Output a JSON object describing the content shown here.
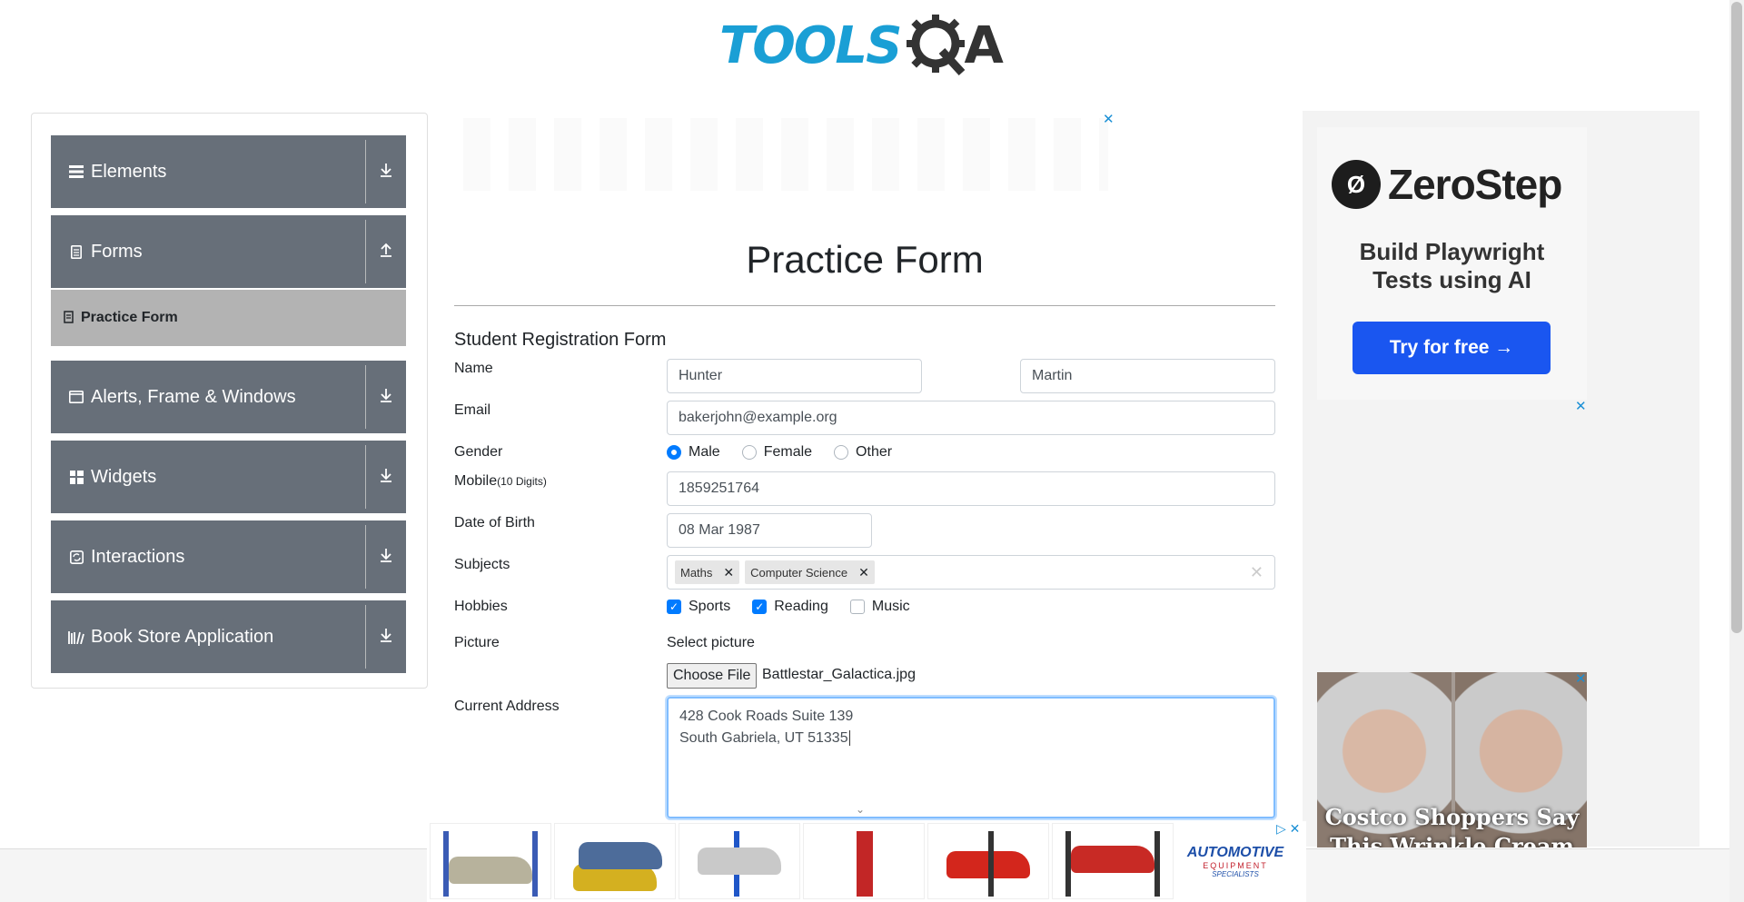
{
  "logo": {
    "text": "TOOLS",
    "tail": "A"
  },
  "sidebar": {
    "groups": [
      {
        "label": "Elements",
        "icon": "menu-icon",
        "arrow": "download-arrow-icon"
      },
      {
        "label": "Forms",
        "icon": "file-icon",
        "arrow": "upload-arrow-icon"
      },
      {
        "label": "Alerts, Frame & Windows",
        "icon": "window-icon",
        "arrow": "download-arrow-icon"
      },
      {
        "label": "Widgets",
        "icon": "grid-icon",
        "arrow": "download-arrow-icon"
      },
      {
        "label": "Interactions",
        "icon": "refresh-icon",
        "arrow": "download-arrow-icon"
      },
      {
        "label": "Book Store Application",
        "icon": "books-icon",
        "arrow": "download-arrow-icon"
      }
    ],
    "active_item": "Practice Form"
  },
  "main": {
    "page_title": "Practice Form",
    "form_title": "Student Registration Form",
    "labels": {
      "name": "Name",
      "email": "Email",
      "gender": "Gender",
      "mobile": "Mobile",
      "mobile_hint": "(10 Digits)",
      "dob": "Date of Birth",
      "subjects": "Subjects",
      "hobbies": "Hobbies",
      "picture": "Picture",
      "address": "Current Address"
    },
    "first_name": "Hunter",
    "last_name": "Martin",
    "email": "bakerjohn@example.org",
    "gender_options": [
      "Male",
      "Female",
      "Other"
    ],
    "gender_selected": "Male",
    "mobile": "1859251764",
    "dob": "08 Mar 1987",
    "subjects": [
      "Maths",
      "Computer Science"
    ],
    "hobbies": [
      {
        "label": "Sports",
        "checked": true
      },
      {
        "label": "Reading",
        "checked": true
      },
      {
        "label": "Music",
        "checked": false
      }
    ],
    "select_picture": "Select picture",
    "choose_file": "Choose File",
    "file_name": "Battlestar_Galactica.jpg",
    "address_line1": "428 Cook Roads Suite 139",
    "address_line2": "South Gabriela, UT 51335"
  },
  "ads": {
    "zerostep": {
      "brand": "ZeroStep",
      "tagline1": "Build Playwright",
      "tagline2": "Tests using AI",
      "cta": "Try for free →"
    },
    "costco": {
      "headline": "Costco Shoppers Say This Wrinkle Cream is"
    },
    "bottom": {
      "brand1": "AUTOMOTIVE",
      "brand2": "EQUIPMENT",
      "brand3": "SPECIALISTS"
    }
  },
  "colors": {
    "sidebar_group": "#676f79",
    "active_item": "#b3b3b3",
    "accent": "#007bff",
    "logo_blue": "#1a9fd5"
  }
}
